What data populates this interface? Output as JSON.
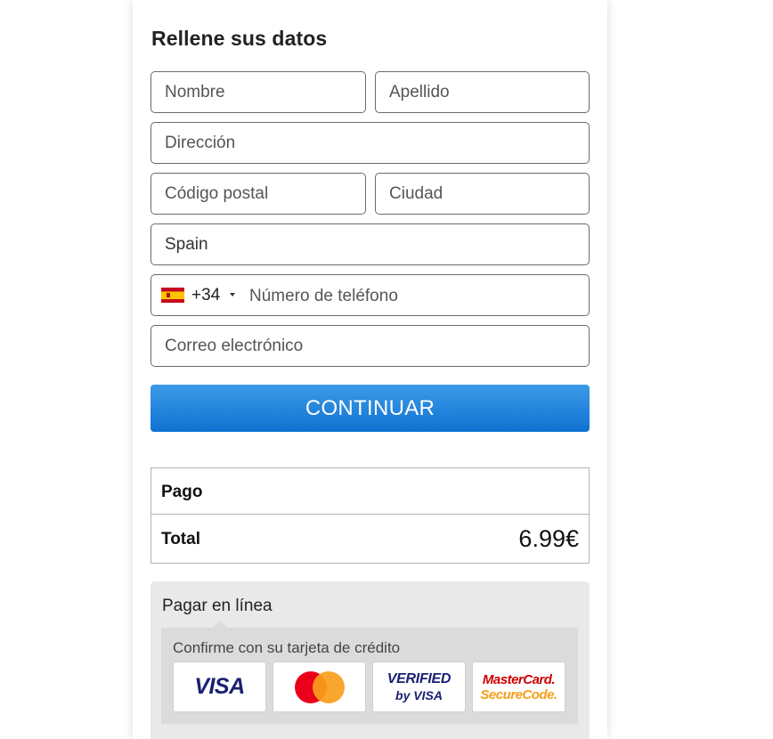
{
  "form": {
    "title": "Rellene sus datos",
    "first_name_placeholder": "Nombre",
    "last_name_placeholder": "Apellido",
    "address_placeholder": "Dirección",
    "postal_code_placeholder": "Código postal",
    "city_placeholder": "Ciudad",
    "country_value": "Spain",
    "phone": {
      "country_flag": "spain-flag-icon",
      "dial_code": "+34",
      "placeholder": "Número de teléfono"
    },
    "email_placeholder": "Correo electrónico",
    "continue_label": "CONTINUAR"
  },
  "summary": {
    "payment_label": "Pago",
    "total_label": "Total",
    "total_amount": "6.99€"
  },
  "payment": {
    "title": "Pagar en línea",
    "subtitle": "Confirme con su tarjeta de crédito",
    "logos": {
      "visa": "VISA",
      "mastercard": "mastercard-logo",
      "verified_line1": "VERIFIED",
      "verified_line2": "by VISA",
      "securecode_line1": "MasterCard.",
      "securecode_line2": "SecureCode."
    }
  },
  "colors": {
    "button_top": "#3c9be8",
    "button_bottom": "#0e72d1",
    "visa_blue": "#1a1f71",
    "mc_red": "#eb001b",
    "mc_orange": "#f79e1b",
    "panel_bg": "#eae9ea"
  }
}
